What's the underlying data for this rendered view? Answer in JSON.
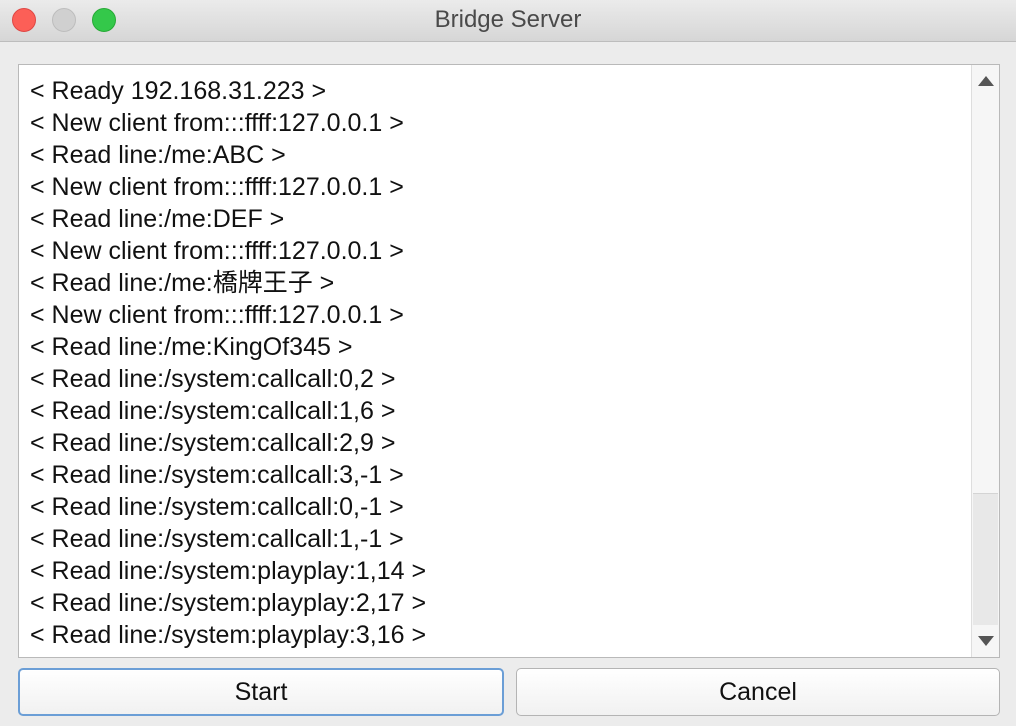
{
  "window": {
    "title": "Bridge Server"
  },
  "log": {
    "lines": [
      "< Ready 192.168.31.223 >",
      "< New client from:::ffff:127.0.0.1 >",
      "< Read line:/me:ABC >",
      "< New client from:::ffff:127.0.0.1 >",
      "< Read line:/me:DEF >",
      "< New client from:::ffff:127.0.0.1 >",
      "< Read line:/me:橋牌王子 >",
      "< New client from:::ffff:127.0.0.1 >",
      "< Read line:/me:KingOf345 >",
      "< Read line:/system:callcall:0,2 >",
      "< Read line:/system:callcall:1,6 >",
      "< Read line:/system:callcall:2,9 >",
      "< Read line:/system:callcall:3,-1 >",
      "< Read line:/system:callcall:0,-1 >",
      "< Read line:/system:callcall:1,-1 >",
      "< Read line:/system:playplay:1,14 >",
      "< Read line:/system:playplay:2,17 >",
      "< Read line:/system:playplay:3,16 >"
    ]
  },
  "buttons": {
    "start_label": "Start",
    "cancel_label": "Cancel"
  },
  "colors": {
    "close": "#fc5f57",
    "minimize": "#d0d0d0",
    "zoom": "#34c84a",
    "default_button_border": "#6b9ed6"
  }
}
